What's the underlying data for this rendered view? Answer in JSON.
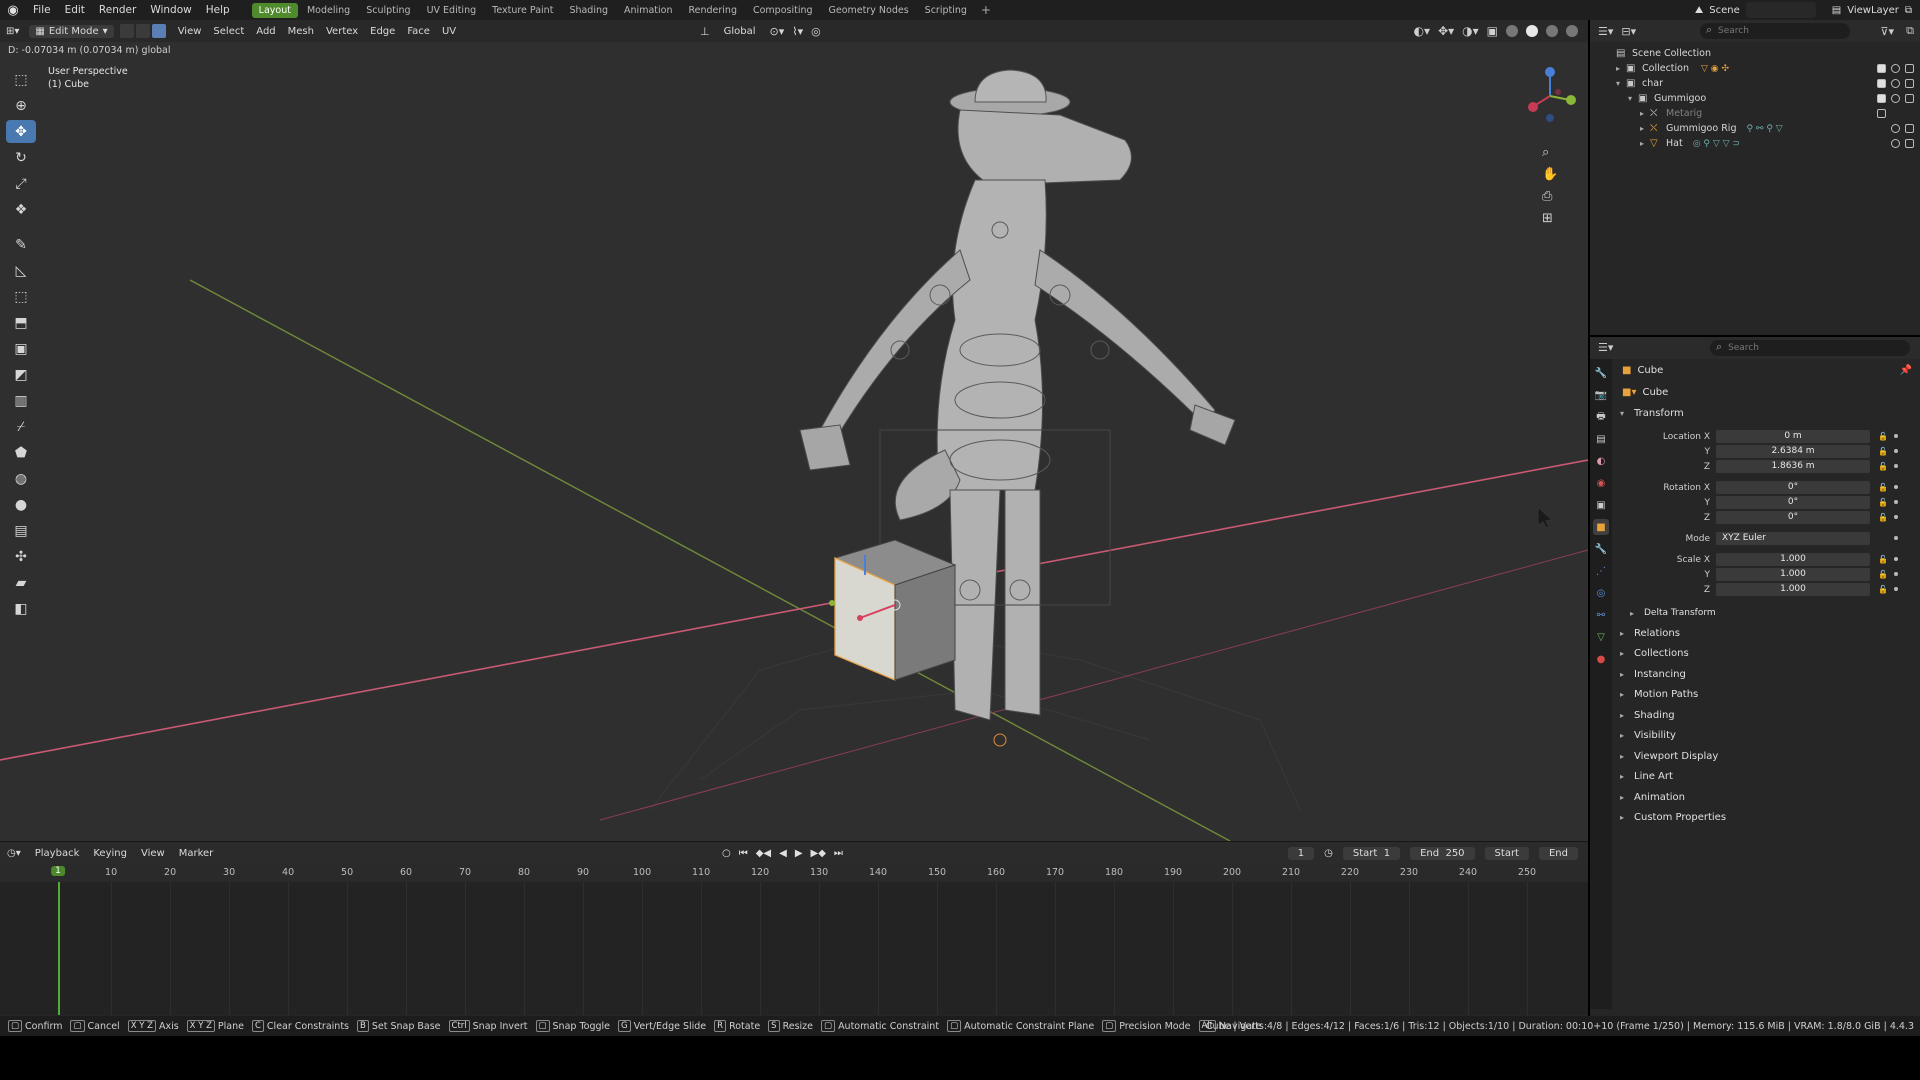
{
  "topbar": {
    "menus": [
      "File",
      "Edit",
      "Render",
      "Window",
      "Help"
    ],
    "workspaces": [
      "Layout",
      "Modeling",
      "Sculpting",
      "UV Editing",
      "Texture Paint",
      "Shading",
      "Animation",
      "Rendering",
      "Compositing",
      "Geometry Nodes",
      "Scripting"
    ],
    "active_workspace": "Layout",
    "scene": "Scene",
    "view_layer": "ViewLayer"
  },
  "viewport": {
    "mode": "Edit Mode",
    "menus": [
      "View",
      "Select",
      "Add",
      "Mesh",
      "Vertex",
      "Edge",
      "Face",
      "UV"
    ],
    "orientation": "Global",
    "readout": "D: -0.07034 m (0.07034 m) global",
    "perspective": "User Perspective",
    "object_label": "(1) Cube"
  },
  "timeline": {
    "menus": [
      "Playback",
      "Keying",
      "View",
      "Marker"
    ],
    "current_frame": "1",
    "start_label": "Start",
    "start": "1",
    "end_label": "End",
    "end": "250",
    "marker_start": "Start",
    "marker_end": "End",
    "ruler": [
      "1",
      "10",
      "20",
      "30",
      "40",
      "50",
      "60",
      "70",
      "80",
      "90",
      "100",
      "110",
      "120",
      "130",
      "140",
      "150",
      "160",
      "170",
      "180",
      "190",
      "200",
      "210",
      "220",
      "230",
      "240",
      "250"
    ]
  },
  "statusbar": {
    "hints": [
      {
        "key": "",
        "label": "Confirm"
      },
      {
        "key": "",
        "label": "Cancel"
      },
      {
        "key": "X Y Z",
        "label": "Axis"
      },
      {
        "key": "X Y Z",
        "label": "Plane"
      },
      {
        "key": "C",
        "label": "Clear Constraints"
      },
      {
        "key": "B",
        "label": "Set Snap Base"
      },
      {
        "key": "Ctrl",
        "label": "Snap Invert"
      },
      {
        "key": "",
        "label": "Snap Toggle"
      },
      {
        "key": "G",
        "label": "Vert/Edge Slide"
      },
      {
        "key": "R",
        "label": "Rotate"
      },
      {
        "key": "S",
        "label": "Resize"
      },
      {
        "key": "",
        "label": "Automatic Constraint"
      },
      {
        "key": "",
        "label": "Automatic Constraint Plane"
      },
      {
        "key": "",
        "label": "Precision Mode"
      },
      {
        "key": "Alt",
        "label": "Navigate"
      }
    ],
    "stats": "Cube | Verts:4/8 | Edges:4/12 | Faces:1/6 | Tris:12 | Objects:1/10 | Duration: 00:10+10 (Frame 1/250) | Memory: 115.6 MiB | VRAM: 1.8/8.0 GiB | 4.4.3"
  },
  "outliner": {
    "search_placeholder": "Search",
    "rows": [
      {
        "label": "Scene Collection"
      },
      {
        "label": "Collection"
      },
      {
        "label": "char"
      },
      {
        "label": "Gummigoo"
      },
      {
        "label": "Metarig"
      },
      {
        "label": "Gummigoo Rig"
      },
      {
        "label": "Hat"
      }
    ]
  },
  "properties": {
    "search_placeholder": "Search",
    "object_name": "Cube",
    "data_name": "Cube",
    "transform": {
      "title": "Transform",
      "location_label": "Location X",
      "loc_x": "0 m",
      "loc_y": "2.6384 m",
      "loc_z": "1.8636 m",
      "rotation_label": "Rotation X",
      "rot_x": "0°",
      "rot_y": "0°",
      "rot_z": "0°",
      "mode_label": "Mode",
      "mode": "XYZ Euler",
      "scale_label": "Scale X",
      "scale_x": "1.000",
      "scale_y": "1.000",
      "scale_z": "1.000",
      "y_label": "Y",
      "z_label": "Z"
    },
    "delta": "Delta Transform",
    "panels": [
      "Relations",
      "Collections",
      "Instancing",
      "Motion Paths",
      "Shading",
      "Visibility",
      "Viewport Display",
      "Line Art",
      "Animation",
      "Custom Properties"
    ]
  },
  "colors": {
    "active_workspace": "#4f8a2c",
    "x_axis": "#c85a72",
    "y_axis": "#6f8a3a",
    "tool_active": "#4a78b0",
    "object_orange": "#e8a23a"
  }
}
